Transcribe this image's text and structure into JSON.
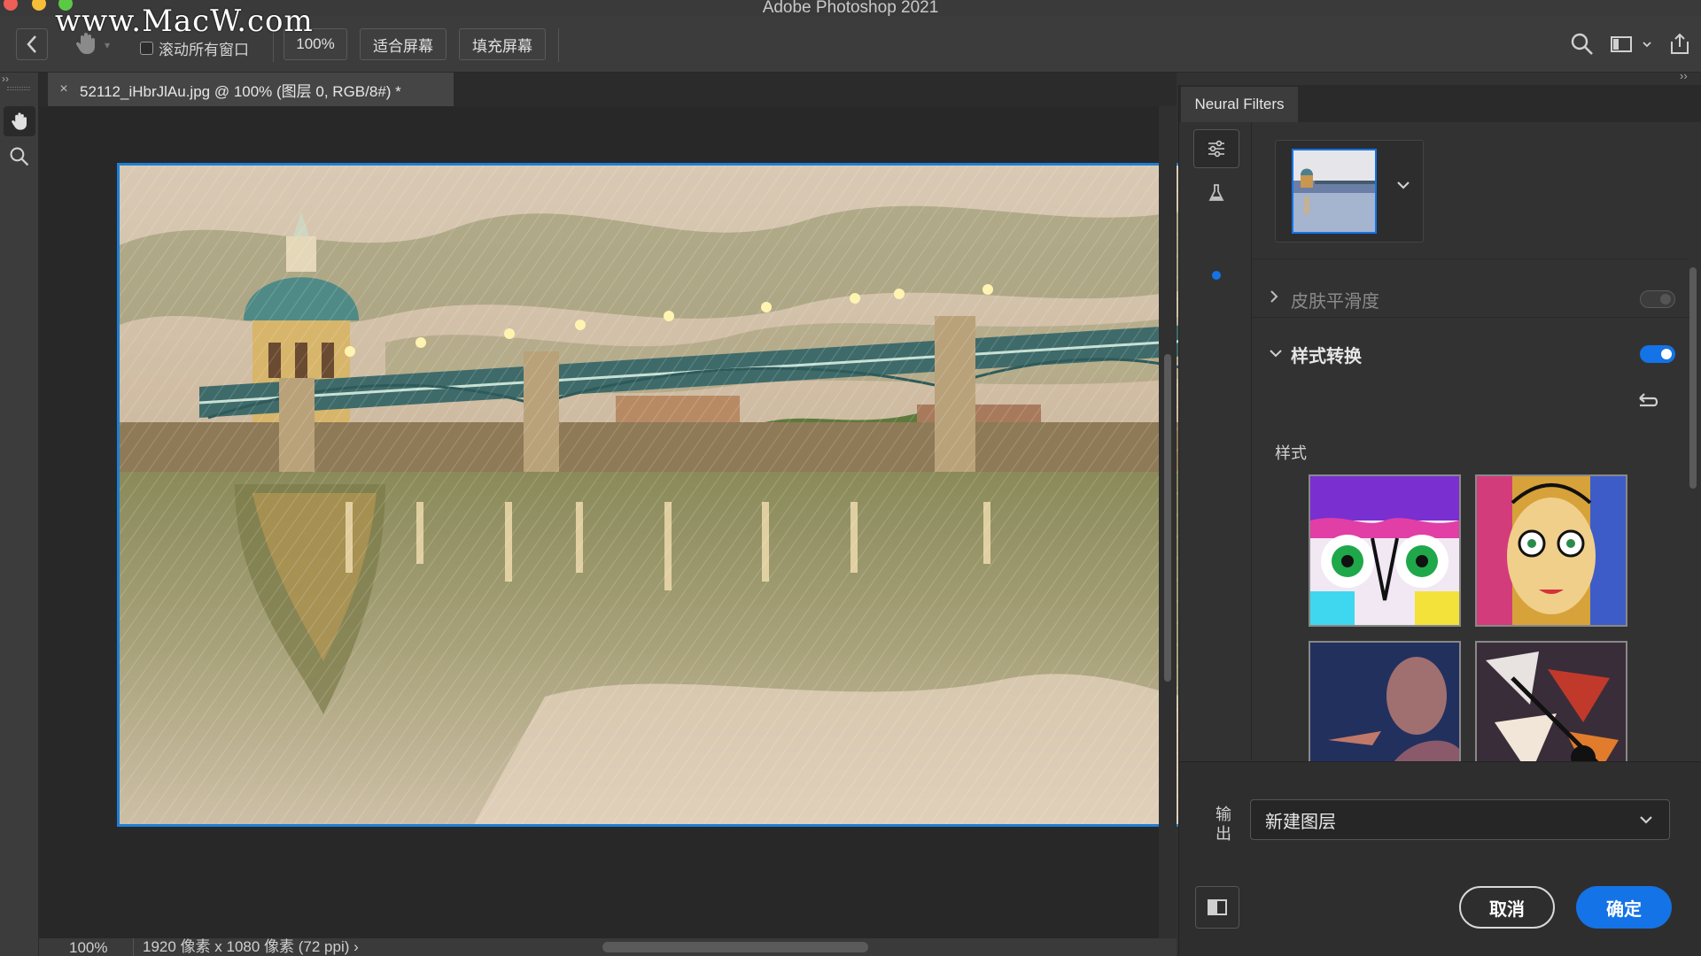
{
  "window": {
    "title": "Adobe Photoshop 2021",
    "watermark": "www.MacW.com"
  },
  "options_bar": {
    "scroll_all_windows_label": "滚动所有窗口",
    "scroll_all_windows_checked": false,
    "zoom_button": "100%",
    "fit_screen_button": "适合屏幕",
    "fill_screen_button": "填充屏幕"
  },
  "toolbar": {
    "tools": [
      "hand-tool",
      "zoom-tool"
    ],
    "active_tool": "hand-tool"
  },
  "document": {
    "tab_title": "52112_iHbrJlAu.jpg @ 100% (图层 0, RGB/8#) *",
    "close_glyph": "×"
  },
  "status_bar": {
    "zoom": "100%",
    "dimensions": "1920 像素 x 1080 像素 (72 ppi)",
    "arrow": "›"
  },
  "neural_filters": {
    "panel_tab": "Neural Filters",
    "filters": [
      {
        "label": "皮肤平滑度",
        "expanded": false,
        "enabled": false
      },
      {
        "label": "样式转换",
        "expanded": true,
        "enabled": true
      }
    ],
    "styles_label": "样式",
    "styles": [
      "neon-cartoon-eyes",
      "colorful-face-painting",
      "dark-figure-portrait",
      "cubist-collage"
    ],
    "output_label": "输出",
    "output_value": "新建图层",
    "cancel_button": "取消",
    "ok_button": "确定"
  },
  "colors": {
    "accent": "#1473e6",
    "artboard_border": "#1d7fd6",
    "panel_bg": "#323232",
    "canvas_bg": "#282828"
  }
}
